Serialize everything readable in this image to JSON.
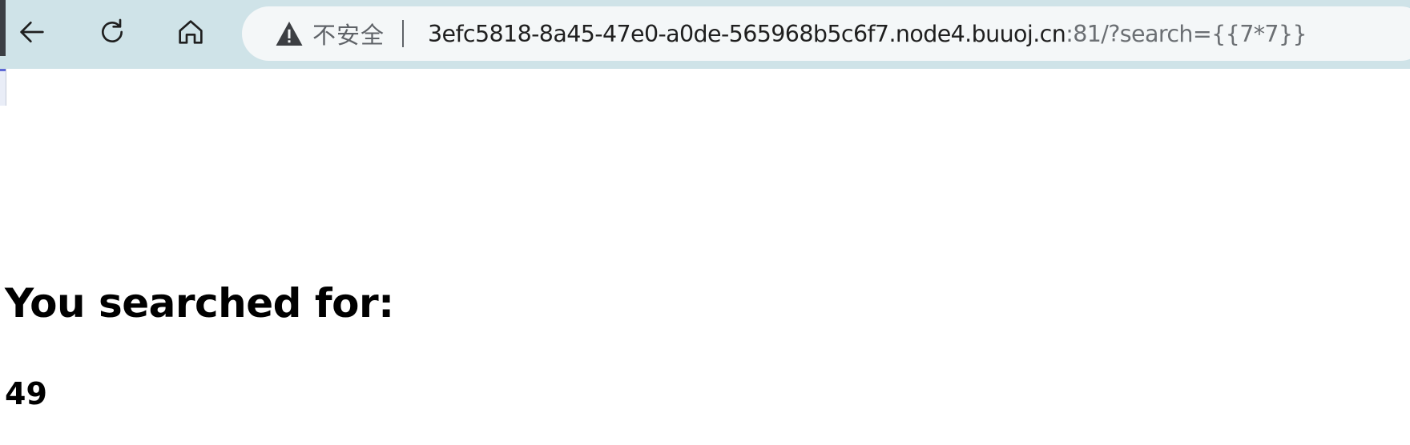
{
  "browser": {
    "address_bar": {
      "security_label": "不安全",
      "url_host": "3efc5818-8a45-47e0-a0de-565968b5c6f7.node4.buuoj.cn",
      "url_rest": ":81/?search={{7*7}}"
    },
    "icons": {
      "back": "back-arrow-icon",
      "reload": "reload-icon",
      "home": "home-icon",
      "security": "warning-triangle-icon"
    },
    "colors": {
      "toolbar": "#cfe3e8",
      "address_bar": "#f4f7f8"
    }
  },
  "page": {
    "heading": "You searched for:",
    "result": "49"
  }
}
